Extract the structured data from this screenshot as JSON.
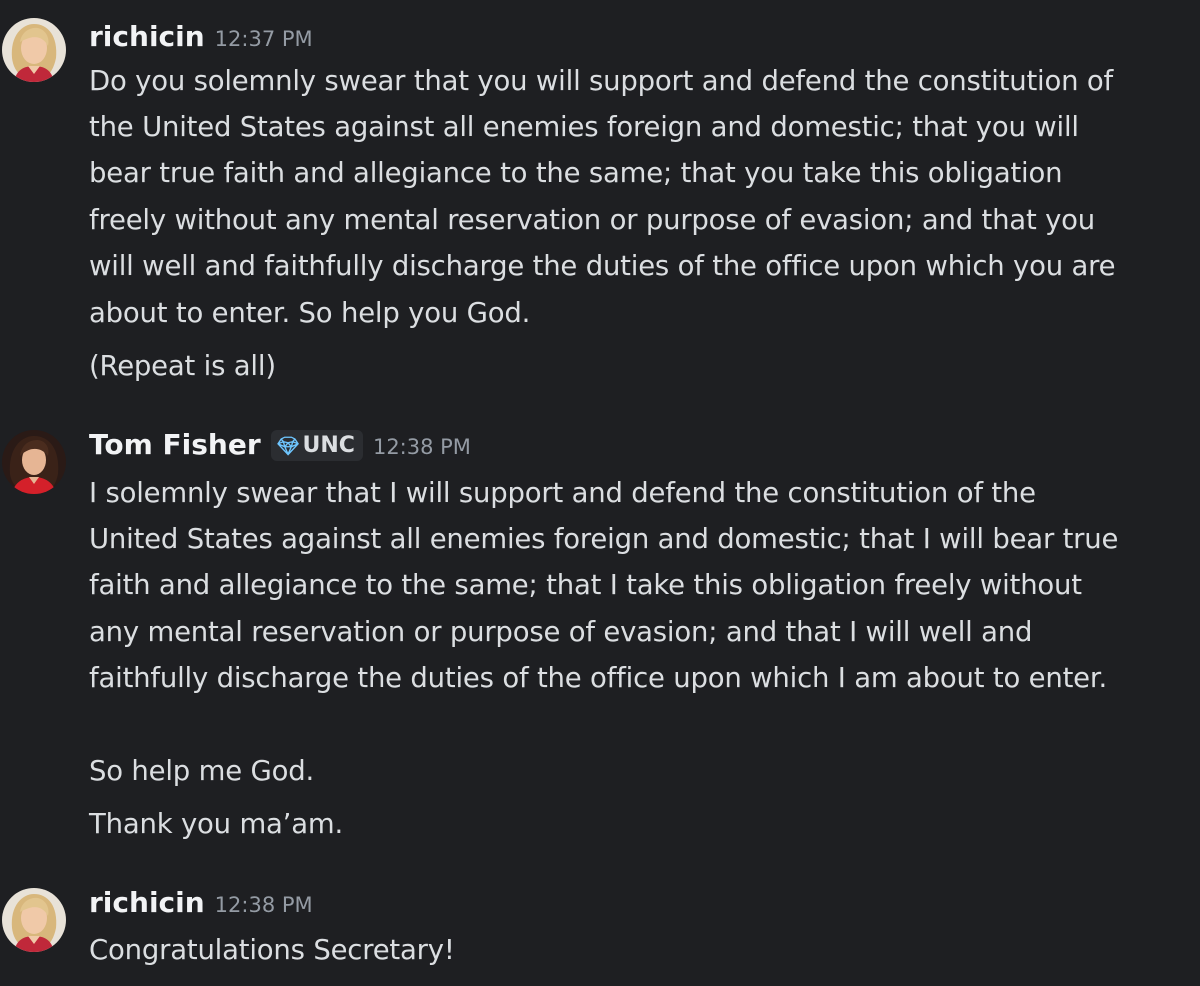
{
  "messages": [
    {
      "username": "richicin",
      "timestamp": "12:37 PM",
      "avatar": "avatar-blonde-woman",
      "lines": [
        "Do you solemnly swear that you will support and defend the constitution of",
        "the United States against all enemies foreign and domestic; that you will",
        "bear true faith and allegiance to the same; that you take this obligation",
        "freely without any mental reservation or purpose of evasion; and that you",
        "will well and faithfully discharge the duties of the office upon which you are",
        "about to enter. So help you God."
      ],
      "followup": "(Repeat is all)"
    },
    {
      "username": "Tom Fisher",
      "tag_icon": "gem-icon",
      "tag": "UNC",
      "timestamp": "12:38 PM",
      "avatar": "avatar-dark-haired-woman-red",
      "lines": [
        "I solemnly swear that I will support and defend the constitution of the",
        "United States against all enemies foreign and domestic; that I will bear true",
        "faith and allegiance to the same; that I take this obligation freely without",
        "any mental reservation or purpose of evasion; and that I will well and",
        "faithfully discharge the duties of the office upon which I am about to enter."
      ],
      "followup_1": "So help me God.",
      "followup_2": "Thank you ma’am."
    },
    {
      "username": "richicin",
      "timestamp": "12:38 PM",
      "avatar": "avatar-blonde-woman",
      "lines": [
        "Congratulations Secretary!"
      ]
    }
  ],
  "colors": {
    "background": "#1e1f22",
    "username": "#f2f3f5",
    "text": "#dbdee1",
    "timestamp": "#949ba4",
    "tag_background": "#2b2d31",
    "gem": "#6ec6ff"
  }
}
